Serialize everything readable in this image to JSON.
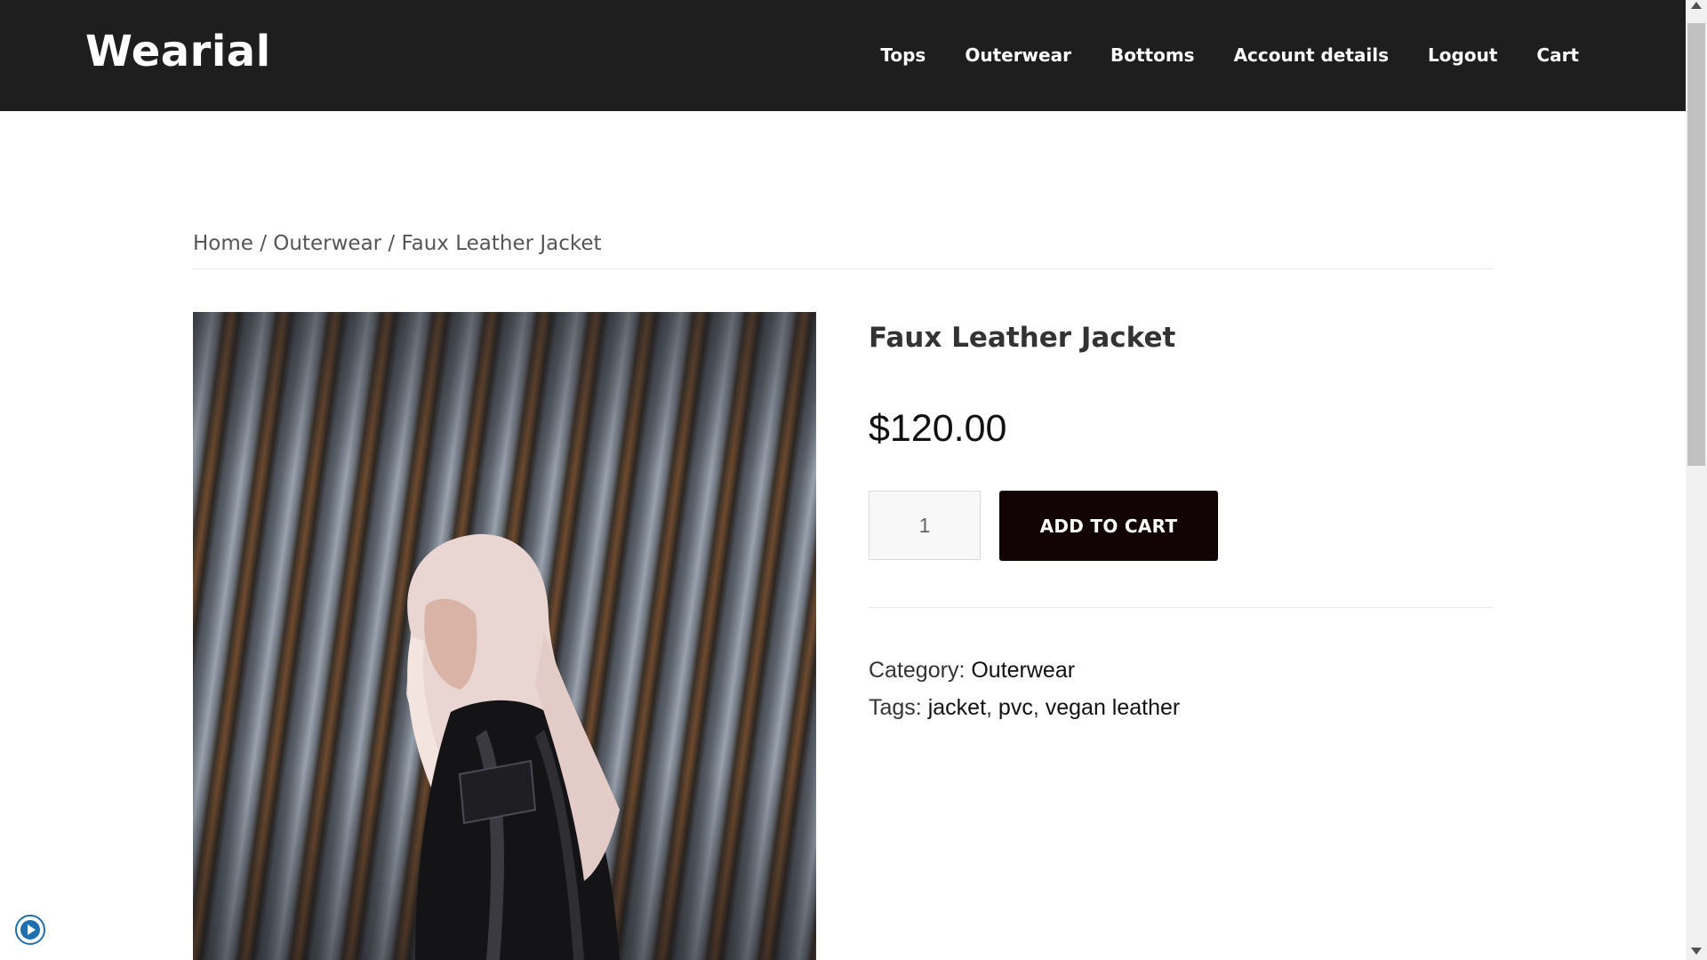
{
  "site": {
    "logo": "Wearial"
  },
  "nav": {
    "items": [
      {
        "label": "Tops"
      },
      {
        "label": "Outerwear"
      },
      {
        "label": "Bottoms"
      },
      {
        "label": "Account details"
      },
      {
        "label": "Logout"
      },
      {
        "label": "Cart"
      }
    ]
  },
  "breadcrumb": {
    "home": "Home",
    "sep1": " / ",
    "category": "Outerwear",
    "sep2": " / ",
    "current": "Faux Leather Jacket"
  },
  "product": {
    "title": "Faux Leather Jacket",
    "price": "$120.00",
    "quantity": "1",
    "add_to_cart_label": "ADD TO CART",
    "category_label": "Category: ",
    "category": "Outerwear",
    "tags_label": "Tags: ",
    "tags": [
      "jacket",
      "pvc",
      "vegan leather"
    ],
    "tag_separator": ", "
  },
  "colors": {
    "header_bg": "#1e1e1e",
    "button_bg": "#120405",
    "accent_blue": "#1e6fb0"
  },
  "icons": {
    "accessibility": "accessibility-play-icon",
    "scroll_up": "scroll-up-arrow-icon",
    "scroll_down": "scroll-down-arrow-icon"
  }
}
